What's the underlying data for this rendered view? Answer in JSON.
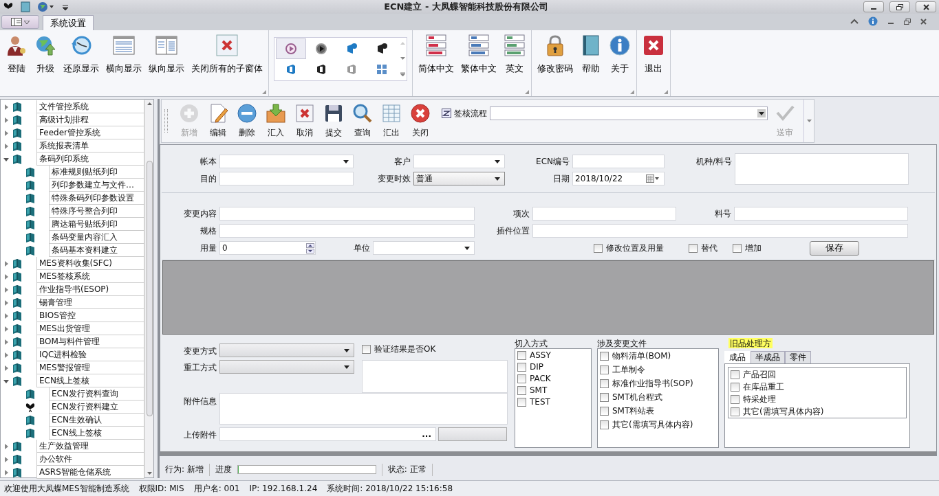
{
  "title_bar": {
    "title": "ECN建立 - 大凤蝶智能科技股份有限公司"
  },
  "ribbon": {
    "tabs": [
      {
        "label": "系统设置",
        "selected": true
      }
    ],
    "groups": [
      {
        "kind": "buttons",
        "buttons": [
          "登陆",
          "升级",
          "还原显示",
          "横向显示",
          "纵向显示",
          "关闭所有的子窗体"
        ]
      },
      {
        "kind": "gallery",
        "items": [
          {
            "selected": true
          },
          {
            "selected": false
          },
          {
            "selected": false
          },
          {
            "selected": false
          },
          {
            "selected": false
          },
          {
            "selected": false
          },
          {
            "selected": false
          },
          {
            "selected": false
          }
        ]
      },
      {
        "kind": "buttons",
        "buttons": [
          "简体中文",
          "繁体中文",
          "英文"
        ]
      },
      {
        "kind": "buttons",
        "buttons": [
          "修改密码",
          "帮助",
          "关于"
        ]
      },
      {
        "kind": "buttons",
        "buttons": [
          "退出"
        ]
      }
    ]
  },
  "sidebar": {
    "items": [
      {
        "label": "文件管控系统",
        "expanded": false
      },
      {
        "label": "高级计划排程",
        "expanded": false
      },
      {
        "label": "Feeder管控系统",
        "expanded": false
      },
      {
        "label": "系统报表清单",
        "expanded": false
      },
      {
        "label": "条码列印系统",
        "expanded": true,
        "children": [
          {
            "label": "标准规则贴纸列印",
            "open": false
          },
          {
            "label": "列印参数建立与文件…",
            "open": false
          },
          {
            "label": "特殊条码列印参数设置",
            "open": false
          },
          {
            "label": "特殊序号整合列印",
            "open": false
          },
          {
            "label": "腾达箱号贴纸列印",
            "open": false
          },
          {
            "label": "条码变量内容汇入",
            "open": false
          },
          {
            "label": "条码基本资料建立",
            "open": false
          }
        ]
      },
      {
        "label": "MES资料收集(SFC)",
        "expanded": false
      },
      {
        "label": "MES签核系统",
        "expanded": false
      },
      {
        "label": "作业指导书(ESOP)",
        "expanded": false
      },
      {
        "label": "锡膏管理",
        "expanded": false
      },
      {
        "label": "BIOS管控",
        "expanded": false
      },
      {
        "label": "MES出货管理",
        "expanded": false
      },
      {
        "label": "BOM与料件管理",
        "expanded": false
      },
      {
        "label": "IQC进料检验",
        "expanded": false
      },
      {
        "label": "MES警报管理",
        "expanded": false
      },
      {
        "label": "ECN线上签核",
        "expanded": true,
        "children": [
          {
            "label": "ECN发行资料查询",
            "open": false
          },
          {
            "label": "ECN发行资料建立",
            "open": true
          },
          {
            "label": "ECN生效确认",
            "open": false
          },
          {
            "label": "ECN线上签核",
            "open": false
          }
        ]
      },
      {
        "label": "生产效益管理",
        "expanded": false
      },
      {
        "label": "办公软件",
        "expanded": false
      },
      {
        "label": "ASRS智能仓储系统",
        "expanded": false
      }
    ]
  },
  "toolbar": {
    "buttons": [
      {
        "label": "新增",
        "disabled": true
      },
      {
        "label": "编辑",
        "disabled": false
      },
      {
        "label": "删除",
        "disabled": false
      },
      {
        "label": "汇入",
        "disabled": false
      },
      {
        "label": "取消",
        "disabled": false
      },
      {
        "label": "提交",
        "disabled": false
      },
      {
        "label": "查询",
        "disabled": false
      },
      {
        "label": "汇出",
        "disabled": false
      },
      {
        "label": "关闭",
        "disabled": false
      }
    ],
    "workflow": {
      "label": "签核流程"
    },
    "submit": {
      "label": "送审",
      "disabled": true
    }
  },
  "header": {
    "account": {
      "label": "帐本"
    },
    "customer": {
      "label": "客户"
    },
    "ecn_no": {
      "label": "ECN编号"
    },
    "model_part": {
      "label": "机种/料号"
    },
    "purpose": {
      "label": "目的"
    },
    "effectivity": {
      "label": "变更时效",
      "value": "普通"
    },
    "date": {
      "label": "日期",
      "value": "2018/10/22"
    }
  },
  "detail": {
    "change_content": {
      "label": "变更内容"
    },
    "item_no": {
      "label": "项次"
    },
    "part_no": {
      "label": "料号"
    },
    "spec": {
      "label": "规格"
    },
    "insert_position": {
      "label": "插件位置"
    },
    "quantity": {
      "label": "用量",
      "value": "0"
    },
    "unit": {
      "label": "单位"
    },
    "options": [
      {
        "label": "修改位置及用量",
        "checked": false
      },
      {
        "label": "替代",
        "checked": false
      },
      {
        "label": "增加",
        "checked": false
      }
    ],
    "save_button": "保存"
  },
  "bottom": {
    "change_method": {
      "label": "变更方式"
    },
    "rework_method": {
      "label": "重工方式"
    },
    "verify_ok": {
      "label": "验证结果是否OK",
      "checked": false
    },
    "attachment_info": {
      "label": "附件信息"
    },
    "upload": {
      "label": "上传附件",
      "browse": "..."
    },
    "cut_in": {
      "title": "切入方式",
      "options": [
        {
          "label": "ASSY",
          "checked": false
        },
        {
          "label": "DIP",
          "checked": false
        },
        {
          "label": "PACK",
          "checked": false
        },
        {
          "label": "SMT",
          "checked": false
        },
        {
          "label": "TEST",
          "checked": false
        }
      ]
    },
    "files": {
      "title": "涉及变更文件",
      "options": [
        {
          "label": "物料清单(BOM)",
          "checked": false
        },
        {
          "label": "工单制令",
          "checked": false
        },
        {
          "label": "标准作业指导书(SOP)",
          "checked": false
        },
        {
          "label": "SMT机台程式",
          "checked": false
        },
        {
          "label": "SMT料站表",
          "checked": false
        },
        {
          "label": "其它(需填写具体内容)",
          "checked": false
        }
      ]
    },
    "old_stock": {
      "title": "旧品处理方",
      "tabs": [
        {
          "label": "成品",
          "selected": true
        },
        {
          "label": "半成品",
          "selected": false
        },
        {
          "label": "零件",
          "selected": false
        }
      ],
      "options": [
        {
          "label": "产品召回",
          "checked": false
        },
        {
          "label": "在库品重工",
          "checked": false
        },
        {
          "label": "特采处理",
          "checked": false
        },
        {
          "label": "其它(需填写具体内容)",
          "checked": false
        }
      ]
    }
  },
  "status_row": {
    "action": "行为: 新增",
    "progress": {
      "label": "进度",
      "level": 0
    },
    "state": "状态: 正常"
  },
  "status_bar": [
    "欢迎使用大凤蝶MES智能制造系统",
    "权限ID: MIS",
    "用户名: 001",
    "IP: 192.168.1.24",
    "系统时间: 2018/10/22 15:16:58"
  ]
}
